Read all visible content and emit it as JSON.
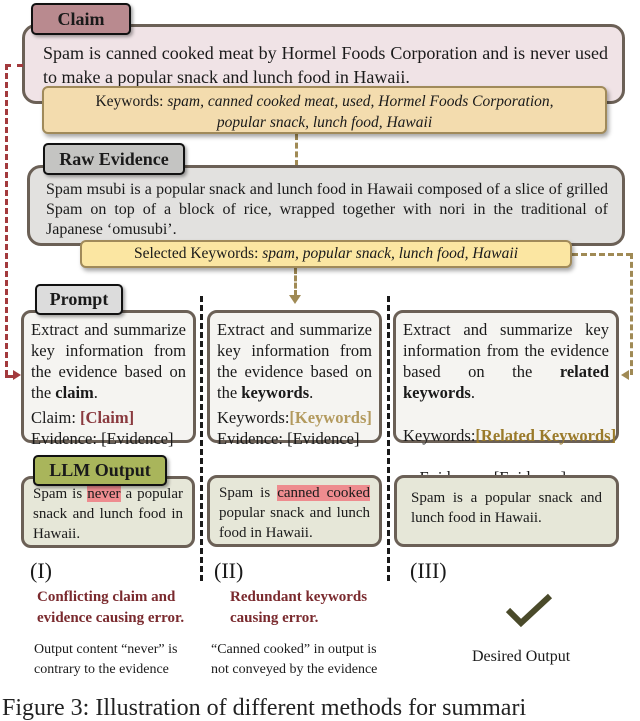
{
  "claim": {
    "tab_label": "Claim",
    "text": "Spam is canned cooked meat by Hormel Foods Corporation and is never used to make a popular snack and lunch food in Hawaii.",
    "keywords_label": "Keywords:",
    "keywords_line1": "spam, canned cooked meat, used, Hormel Foods Corporation,",
    "keywords_line2": "popular snack, lunch food, Hawaii"
  },
  "evidence": {
    "tab_label": "Raw Evidence",
    "text": "Spam msubi is a popular snack and lunch food in Hawaii composed of a slice of grilled Spam on top of a block of rice, wrapped together with nori in the traditional of Japanese ‘omusubi’.",
    "selected_keywords_label": "Selected Keywords:",
    "selected_keywords": "spam, popular snack, lunch food, Hawaii"
  },
  "prompt": {
    "tab_label": "Prompt",
    "methods": [
      {
        "instruction_prefix": "Extract and summarize key information from the evidence based on the ",
        "instruction_bold": "claim",
        "instruction_suffix": ".",
        "field1_label": "Claim: ",
        "field1_value": "[Claim]",
        "field2_label": "Evidence: ",
        "field2_value": "[Evidence]"
      },
      {
        "instruction_prefix": "Extract and summarize key information from the evidence based on the ",
        "instruction_bold": "keywords",
        "instruction_suffix": ".",
        "field1_label": "Keywords:",
        "field1_value": "[Keywords]",
        "field2_label": "Evidence: ",
        "field2_value": "[Evidence]"
      },
      {
        "instruction_prefix": "Extract and summarize key information from the evidence based on the ",
        "instruction_bold": "related keywords",
        "instruction_suffix": ".",
        "field1_label": "Keywords:",
        "field1_value": "[Related Keywords]",
        "field2_label": "Evidence:  ",
        "field2_value": "[Evidence]"
      }
    ]
  },
  "output": {
    "tab_label": "LLM Output",
    "methods": [
      {
        "pre": "Spam is ",
        "highlight": "never",
        "post": " a popular snack and lunch food in Hawaii."
      },
      {
        "pre": "Spam is ",
        "highlight": "canned cooked",
        "post": " popular snack and lunch food in Hawaii."
      },
      {
        "pre": "Spam is a popular snack and lunch food in Hawaii.",
        "highlight": "",
        "post": ""
      }
    ]
  },
  "results": [
    {
      "numeral": "(I)",
      "error_line1": "Conflicting claim and",
      "error_line2": "evidence causing error.",
      "note_line1": "Output content “never” is",
      "note_line2": "contrary to the evidence"
    },
    {
      "numeral": "(II)",
      "error_line1": "Redundant keywords",
      "error_line2": "causing error.",
      "note_line1": "“Canned cooked” in output is",
      "note_line2": "not conveyed by the evidence"
    },
    {
      "numeral": "(III)",
      "check_icon": "checkmark",
      "desired_label": "Desired Output"
    }
  ],
  "caption_partial": "Figure 3: Illustration of different methods for summari",
  "colors": {
    "claim_tab": "#b98a8f",
    "claim_box": "#f0e3e6",
    "keywords_box": "#f3dcae",
    "evidence_tab": "#c4c4c2",
    "evidence_box": "#e2e1df",
    "selected_keywords_box": "#fbe6a2",
    "prompt_tab": "#dcdcdc",
    "output_tab": "#a9b55b",
    "output_box": "#e6e7d8",
    "highlight": "#ee8c8f",
    "claim_ref": "#8a3a3f",
    "keyword_ref": "#b39a5e",
    "related_keyword_ref": "#9a7a2a",
    "error_text": "#7a2a2e",
    "check": "#4a4a2a"
  }
}
